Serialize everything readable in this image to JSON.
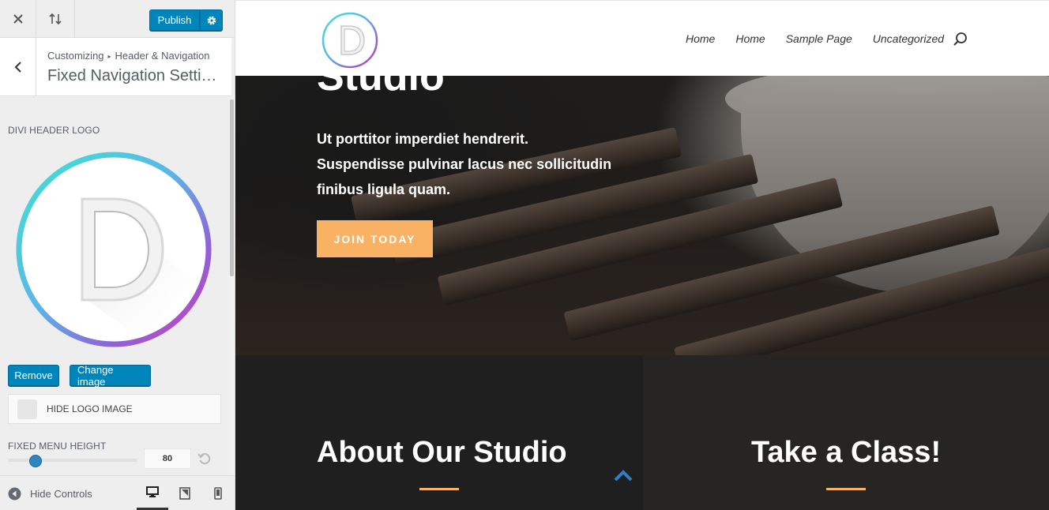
{
  "customizer": {
    "publish_label": "Publish",
    "breadcrumb": [
      "Customizing",
      "Header & Navigation"
    ],
    "section_title": "Fixed Navigation Settings",
    "logo_control": {
      "title": "DIVI HEADER LOGO",
      "remove_label": "Remove",
      "change_label": "Change image"
    },
    "hide_logo_label": "HIDE LOGO IMAGE",
    "fixed_menu_height": {
      "title": "FIXED MENU HEIGHT",
      "value": "80"
    },
    "hide_controls_label": "Hide Controls",
    "devices": [
      "desktop",
      "tablet",
      "mobile"
    ]
  },
  "site": {
    "nav": [
      "Home",
      "Home",
      "Sample Page",
      "Uncategorized"
    ],
    "hero": {
      "title": "Studio",
      "text_lines": [
        "Ut porttitor imperdiet hendrerit.",
        "Suspendisse pulvinar lacus nec sollicitudin",
        "finibus ligula quam."
      ],
      "cta": "JOIN TODAY"
    },
    "about_title": "About Our Studio",
    "class_title": "Take a Class!"
  },
  "colors": {
    "wp_blue": "#0085ba",
    "accent_orange": "#f9b164",
    "dark_section": "#201f1f"
  },
  "icons": [
    "close-icon",
    "reorder-icon",
    "gear-icon",
    "chevron-left-icon",
    "reset-icon",
    "collapse-icon",
    "desktop-icon",
    "tablet-icon",
    "mobile-icon",
    "search-icon",
    "chevron-up-icon"
  ]
}
